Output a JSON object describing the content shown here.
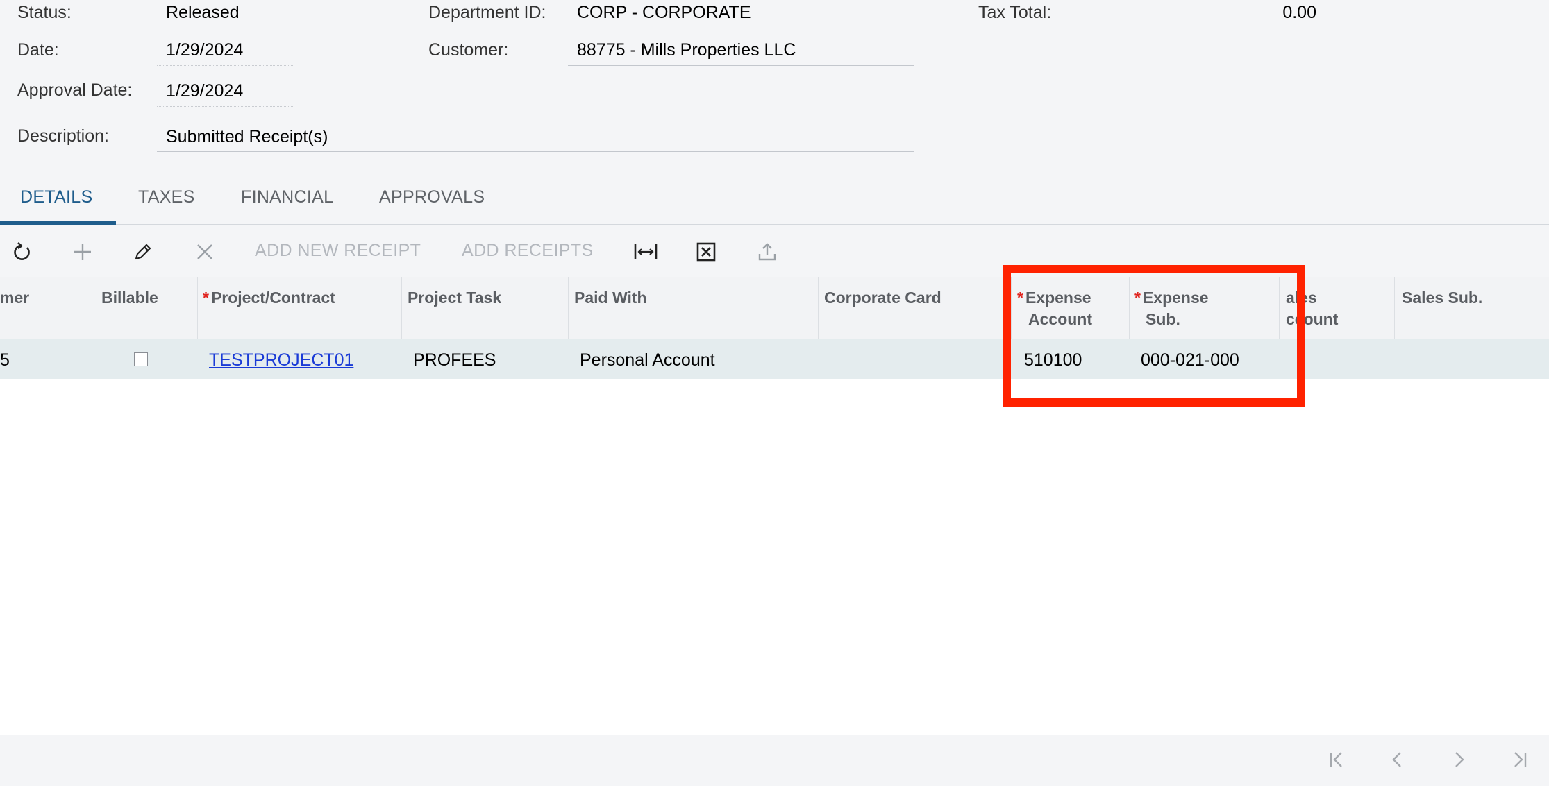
{
  "summary": {
    "status_label": "Status:",
    "status_value": "Released",
    "date_label": "Date:",
    "date_value": "1/29/2024",
    "approval_date_label": "Approval Date:",
    "approval_date_value": "1/29/2024",
    "description_label": "Description:",
    "description_value": "Submitted Receipt(s)",
    "department_label": "Department ID:",
    "department_value": "CORP - CORPORATE",
    "customer_label": "Customer:",
    "customer_value": "88775 - Mills Properties LLC",
    "tax_total_label": "Tax Total:",
    "tax_total_value": "0.00"
  },
  "tabs": [
    {
      "label": "DETAILS",
      "active": true
    },
    {
      "label": "TAXES",
      "active": false
    },
    {
      "label": "FINANCIAL",
      "active": false
    },
    {
      "label": "APPROVALS",
      "active": false
    }
  ],
  "toolbar": {
    "icons": [
      "refresh-icon",
      "plus-icon",
      "pencil-icon",
      "close-icon",
      "fit-columns-icon",
      "excel-export-icon",
      "upload-icon"
    ],
    "add_new_receipt_label": "ADD NEW RECEIPT",
    "add_receipts_label": "ADD RECEIPTS"
  },
  "grid": {
    "columns": {
      "customer": "mer",
      "billable": "Billable",
      "project": "Project/Contract",
      "project_task": "Project Task",
      "paid_with": "Paid With",
      "corporate_card": "Corporate Card",
      "expense_account_1": "Expense",
      "expense_account_2": "Account",
      "expense_sub_1": "Expense",
      "expense_sub_2": "Sub.",
      "sales_account_1": "ales",
      "sales_account_2": "ccount",
      "sales_sub": "Sales Sub."
    },
    "required_marker": "*",
    "row": {
      "customer": "5",
      "billable": false,
      "project": "TESTPROJECT01",
      "project_task": "PROFEES",
      "paid_with": "Personal Account",
      "corporate_card": "",
      "expense_account": "510100",
      "expense_sub": "000-021-000"
    }
  },
  "pager": {
    "icons": [
      "first-page-icon",
      "previous-page-icon",
      "next-page-icon",
      "last-page-icon"
    ]
  },
  "colors": {
    "accent": "#1f5d8c",
    "highlight_box": "#ff2200",
    "required": "#e0241f",
    "link": "#1a3bd6"
  }
}
